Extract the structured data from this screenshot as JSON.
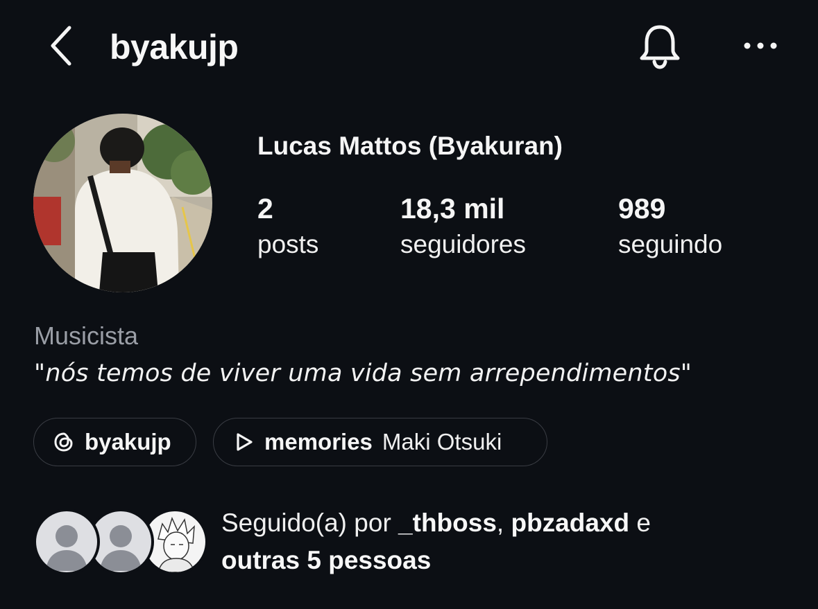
{
  "header": {
    "username": "byakujp",
    "back_icon": "chevron-left-icon",
    "bell_icon": "bell-icon",
    "more_icon": "more-horizontal-icon"
  },
  "profile": {
    "display_name": "Lucas Mattos (Byakuran)",
    "stats": {
      "posts_count": "2",
      "posts_label": "posts",
      "followers_count": "18,3 mil",
      "followers_label": "seguidores",
      "following_count": "989",
      "following_label": "seguindo"
    },
    "category": "Musicista",
    "bio_open_quote": "\"",
    "bio_text": "nós temos de viver uma vida sem arrependimentos",
    "bio_close_quote": "\""
  },
  "links": {
    "threads": {
      "icon": "threads-icon",
      "label": "byakujp"
    },
    "music": {
      "icon": "play-icon",
      "song": "memories",
      "artist": "Maki Otsuki"
    }
  },
  "followed_by": {
    "prefix": "Seguido(a) por ",
    "user1": "_thboss",
    "separator": ", ",
    "user2": "pbzadaxd",
    "conjunction": " e",
    "others": "outras 5 pessoas"
  },
  "colors": {
    "background": "#0c0f14",
    "text_primary": "#f5f5f5",
    "text_secondary": "#9a9ea6",
    "pill_border": "#3a3d44"
  }
}
